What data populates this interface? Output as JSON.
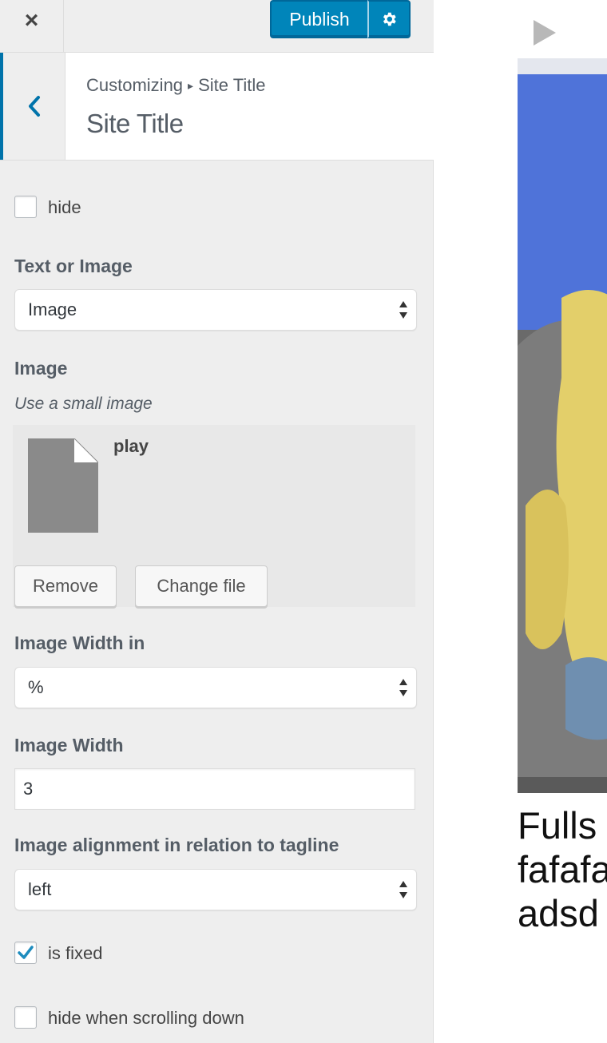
{
  "header": {
    "close_symbol": "×",
    "publish_label": "Publish",
    "settings_icon": "gear-icon"
  },
  "section": {
    "breadcrumb_root": "Customizing",
    "breadcrumb_separator": "▸",
    "breadcrumb_current": "Site Title",
    "title": "Site Title",
    "back_icon": "chevron-left-icon"
  },
  "controls": {
    "hide_label": "hide",
    "hide_checked": false,
    "text_or_image_label": "Text or Image",
    "text_or_image_value": "Image",
    "image_label": "Image",
    "image_description": "Use a small image",
    "image_file_name": "play",
    "remove_label": "Remove",
    "change_file_label": "Change file",
    "width_unit_label": "Image Width in",
    "width_unit_value": "%",
    "width_label": "Image Width",
    "width_value": "3",
    "alignment_label": "Image alignment in relation to tagline",
    "alignment_value": "left",
    "fixed_label": "is fixed",
    "fixed_checked": true,
    "hide_scroll_label": "hide when scrolling down",
    "hide_scroll_checked": false
  },
  "preview": {
    "text_lines": [
      "Fulls",
      "fafafa",
      "adsd"
    ]
  },
  "colors": {
    "accent": "#0085ba",
    "accent_border": "#006799",
    "sidebar_bg": "#eeeeee",
    "checkmark": "#1e8cbe"
  }
}
